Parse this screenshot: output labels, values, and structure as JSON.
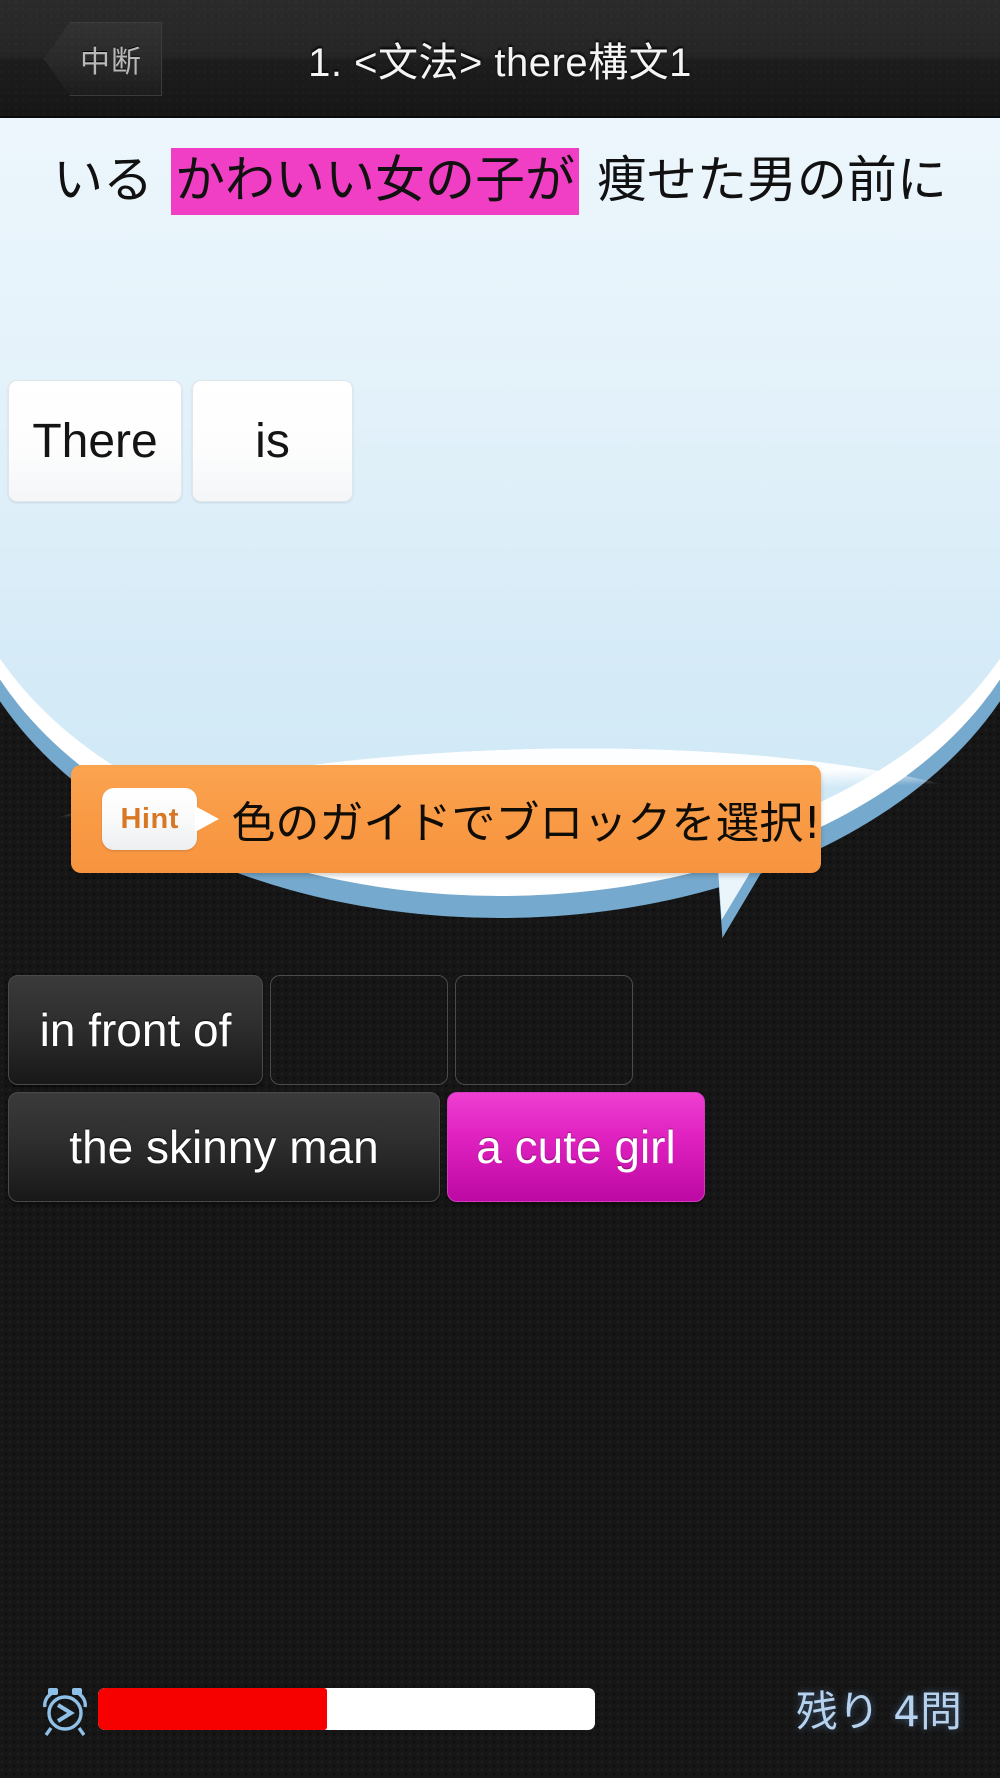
{
  "header": {
    "back_label": "中断",
    "title": "1. <文法> there構文1"
  },
  "question": {
    "prompt_segments": [
      {
        "text": "いる ",
        "highlighted": false
      },
      {
        "text": "かわいい女の子が",
        "highlighted": true
      },
      {
        "text": " 痩せた男の前に",
        "highlighted": false
      }
    ],
    "highlight_color": "#f03fc4",
    "answer_slots": [
      {
        "label": "There"
      },
      {
        "label": "is"
      }
    ]
  },
  "hint": {
    "badge_label": "Hint",
    "text": "色のガイドでブロックを選択!",
    "background_color": "#f89c46"
  },
  "word_bank": {
    "rows": [
      [
        {
          "label": "in front of",
          "state": "filled"
        },
        {
          "label": "",
          "state": "empty"
        },
        {
          "label": "",
          "state": "empty"
        }
      ],
      [
        {
          "label": "the skinny man",
          "state": "filled"
        },
        {
          "label": "a cute girl",
          "state": "accent"
        }
      ]
    ],
    "accent_color": "#d81fbe"
  },
  "footer": {
    "timer_icon": "alarm-clock-icon",
    "progress_percent": 46,
    "progress_fill_color": "#f60000",
    "remaining_label": "残り 4問"
  }
}
